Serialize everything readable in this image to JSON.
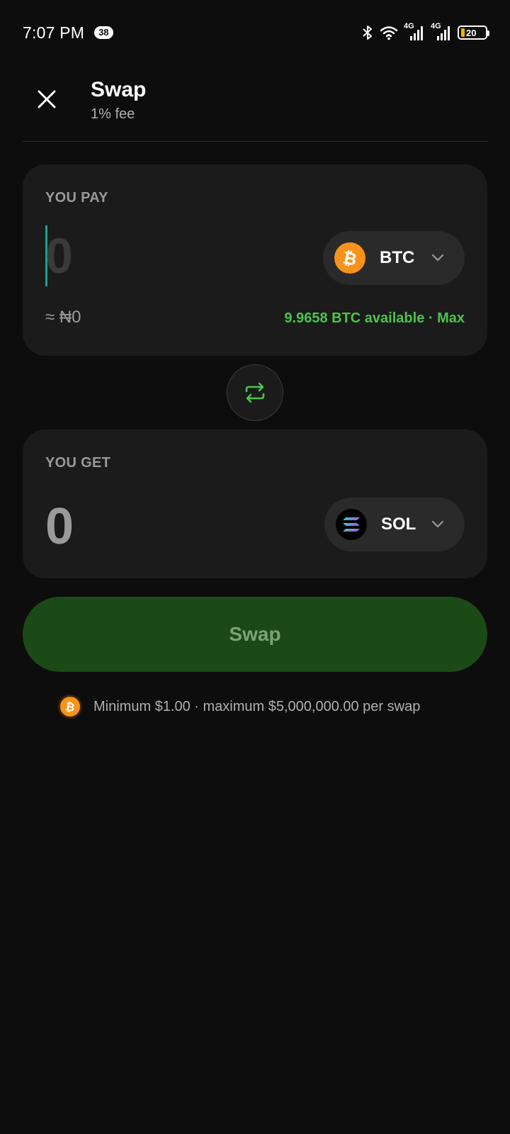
{
  "status_bar": {
    "time": "7:07 PM",
    "notification_count": "38",
    "network_1": "4G",
    "network_2": "4G",
    "battery": "20"
  },
  "header": {
    "title": "Swap",
    "subtitle": "1% fee",
    "close_icon": "close-icon"
  },
  "pay": {
    "label": "YOU PAY",
    "amount_placeholder": "0",
    "token": "BTC",
    "token_icon": "bitcoin-icon",
    "fiat_value": "≈ ₦0",
    "available": "9.9658 BTC available · Max"
  },
  "switch": {
    "icon": "swap-arrows-icon"
  },
  "get": {
    "label": "YOU GET",
    "amount": "0",
    "token": "SOL",
    "token_icon": "solana-icon"
  },
  "swap_button": {
    "label": "Swap"
  },
  "limits": {
    "icon": "bitcoin-icon",
    "text": "Minimum $1.00 · maximum $5,000,000.00 per swap"
  },
  "colors": {
    "background": "#0d0d0d",
    "card": "#1b1b1b",
    "accent_green": "#4ec24e",
    "swap_button_bg": "#1c4a17",
    "btc_orange": "#f7931a",
    "caret": "#17a392"
  }
}
